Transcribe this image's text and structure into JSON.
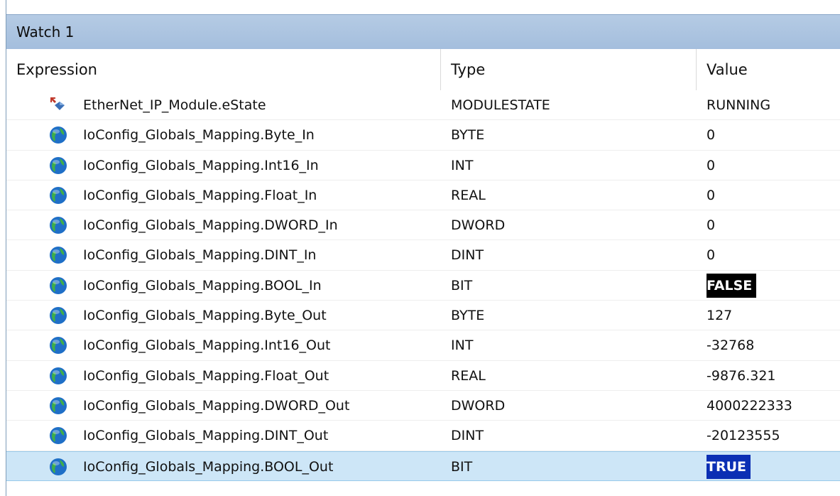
{
  "window": {
    "title": "Watch 1"
  },
  "columns": {
    "expression": "Expression",
    "type": "Type",
    "value": "Value"
  },
  "rows": [
    {
      "expression": "EtherNet_IP_Module.eState",
      "type": "MODULESTATE",
      "value": "RUNNING",
      "icon": "module-state-icon"
    },
    {
      "expression": "IoConfig_Globals_Mapping.Byte_In",
      "type": "BYTE",
      "value": "0",
      "icon": "globe-variable-icon"
    },
    {
      "expression": "IoConfig_Globals_Mapping.Int16_In",
      "type": "INT",
      "value": "0",
      "icon": "globe-variable-icon"
    },
    {
      "expression": "IoConfig_Globals_Mapping.Float_In",
      "type": "REAL",
      "value": "0",
      "icon": "globe-variable-icon"
    },
    {
      "expression": "IoConfig_Globals_Mapping.DWORD_In",
      "type": "DWORD",
      "value": "0",
      "icon": "globe-variable-icon"
    },
    {
      "expression": "IoConfig_Globals_Mapping.DINT_In",
      "type": "DINT",
      "value": "0",
      "icon": "globe-variable-icon"
    },
    {
      "expression": "IoConfig_Globals_Mapping.BOOL_In",
      "type": "BIT",
      "value": "FALSE",
      "icon": "globe-variable-icon"
    },
    {
      "expression": "IoConfig_Globals_Mapping.Byte_Out",
      "type": "BYTE",
      "value": "127",
      "icon": "globe-variable-icon"
    },
    {
      "expression": "IoConfig_Globals_Mapping.Int16_Out",
      "type": "INT",
      "value": "-32768",
      "icon": "globe-variable-icon"
    },
    {
      "expression": "IoConfig_Globals_Mapping.Float_Out",
      "type": "REAL",
      "value": "-9876.321",
      "icon": "globe-variable-icon"
    },
    {
      "expression": "IoConfig_Globals_Mapping.DWORD_Out",
      "type": "DWORD",
      "value": "4000222333",
      "icon": "globe-variable-icon"
    },
    {
      "expression": "IoConfig_Globals_Mapping.DINT_Out",
      "type": "DINT",
      "value": "-20123555",
      "icon": "globe-variable-icon"
    },
    {
      "expression": "IoConfig_Globals_Mapping.BOOL_Out",
      "type": "BIT",
      "value": "TRUE",
      "icon": "globe-variable-icon"
    }
  ],
  "colors": {
    "titlebar": "#a4bedd",
    "selected_row": "#cde6f7",
    "false_badge": "#000000",
    "true_badge": "#0b2fb4"
  }
}
